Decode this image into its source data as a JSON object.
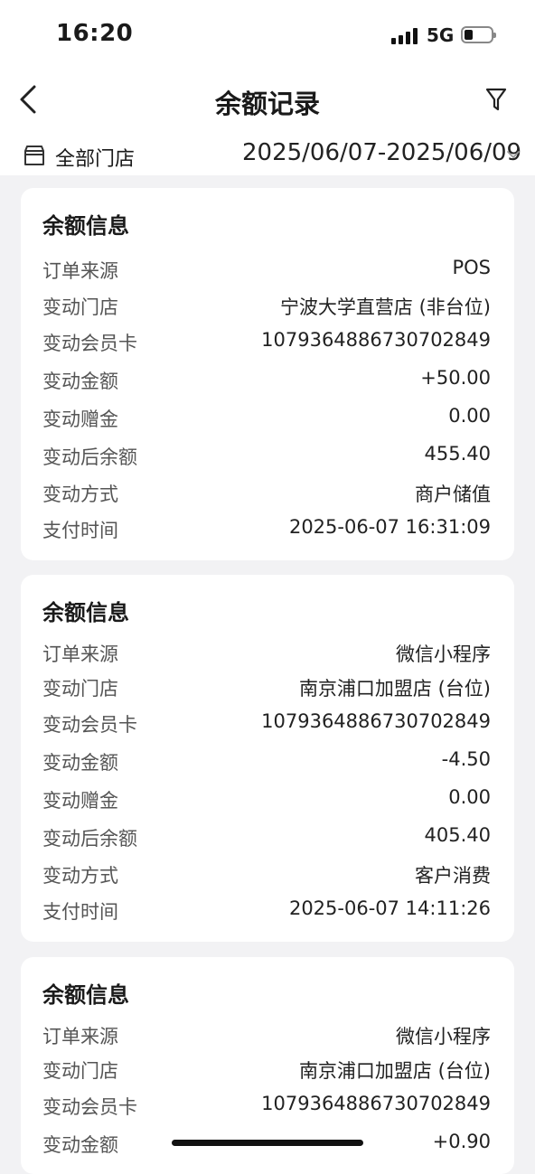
{
  "status_bar": {
    "time": "16:20",
    "network": "5G"
  },
  "header": {
    "title": "余额记录"
  },
  "filter_bar": {
    "store": "全部门店",
    "date_range": "2025/06/07-2025/06/09"
  },
  "labels": {
    "card_title": "余额信息",
    "source": "订单来源",
    "store": "变动门店",
    "card": "变动会员卡",
    "amount": "变动金额",
    "bonus": "变动赠金",
    "balance_after": "变动后余额",
    "method": "变动方式",
    "pay_time": "支付时间"
  },
  "records": [
    {
      "source": "POS",
      "store": "宁波大学直营店 (非台位)",
      "card": "1079364886730702849",
      "amount": "+50.00",
      "bonus": "0.00",
      "balance_after": "455.40",
      "method": "商户储值",
      "pay_time": "2025-06-07 16:31:09"
    },
    {
      "source": "微信小程序",
      "store": "南京浦口加盟店 (台位)",
      "card": "1079364886730702849",
      "amount": "-4.50",
      "bonus": "0.00",
      "balance_after": "405.40",
      "method": "客户消费",
      "pay_time": "2025-06-07 14:11:26"
    },
    {
      "source": "微信小程序",
      "store": "南京浦口加盟店 (台位)",
      "card": "1079364886730702849",
      "amount": "+0.90"
    }
  ]
}
